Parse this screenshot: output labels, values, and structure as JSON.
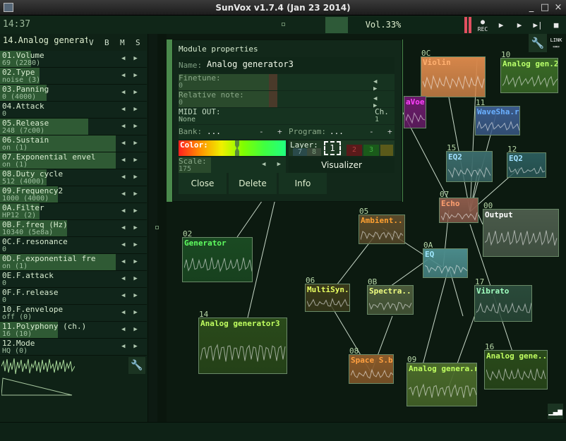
{
  "window": {
    "title": "SunVox v1.7.4 (Jan 23 2014)",
    "min": "_",
    "max": "□",
    "close": "×"
  },
  "topbar": {
    "time": "14:37",
    "volume": "Vol.33%",
    "rec": "REC",
    "play": "▶",
    "pattern_play": "▶",
    "loop": "▶|",
    "stop": "■",
    "link": "LINK"
  },
  "left_panel": {
    "module_name": "14.Analog generatǲ",
    "cols": [
      "V",
      "B",
      "M",
      "S"
    ],
    "params": [
      {
        "name": "01.Volume",
        "value": "69 (2280)",
        "fill": 0.27
      },
      {
        "name": "02.Type",
        "value": "noise (3)",
        "fill": 0.34
      },
      {
        "name": "03.Panning",
        "value": "0 (4000)",
        "fill": 0.4
      },
      {
        "name": "04.Attack",
        "value": "0",
        "fill": 0.0
      },
      {
        "name": "05.Release",
        "value": "248 (7c00)",
        "fill": 0.76
      },
      {
        "name": "06.Sustain",
        "value": "on (1)",
        "fill": 1.0
      },
      {
        "name": "07.Exponential envel",
        "value": "on (1)",
        "fill": 1.0
      },
      {
        "name": "08.Duty cycle",
        "value": "512 (4000)",
        "fill": 0.4
      },
      {
        "name": "09.Frequency2",
        "value": "1000 (4000)",
        "fill": 0.5
      },
      {
        "name": "0A.Filter",
        "value": "HP12 (2)",
        "fill": 0.34
      },
      {
        "name": "0B.F.freq (Hz)",
        "value": "10340 (5e8a)",
        "fill": 0.58
      },
      {
        "name": "0C.F.resonance",
        "value": "0",
        "fill": 0.0
      },
      {
        "name": "0D.F.exponential fre",
        "value": "on (1)",
        "fill": 1.0
      },
      {
        "name": "0E.F.attack",
        "value": "0",
        "fill": 0.0
      },
      {
        "name": "0F.F.release",
        "value": "0",
        "fill": 0.0
      },
      {
        "name": "10.F.envelope",
        "value": "off (0)",
        "fill": 0.0
      },
      {
        "name": "11.Polyphony (ch.)",
        "value": "16 (10)",
        "fill": 0.5
      },
      {
        "name": "12.Mode",
        "value": "HQ (0)",
        "fill": 0.0
      }
    ]
  },
  "dialog": {
    "title": "Module properties",
    "name_label": "Name:",
    "name_value": "Analog generator3",
    "finetune_label": "Finetune:",
    "finetune_value": "0",
    "relnote_label": "Relative note:",
    "relnote_value": "0",
    "midi_label": "MIDI OUT:",
    "midi_value": "None",
    "ch_label": "Ch.",
    "ch_value": "1",
    "bank_label": "Bank:",
    "bank_value": "...",
    "program_label": "Program:",
    "program_value": "...",
    "color_label": "Color:",
    "layer_label": "Layer:",
    "layers": [
      "7",
      "8",
      "1",
      "2",
      "3"
    ],
    "scale_label": "Scale:",
    "scale_value": "175",
    "visualizer": "Visualizer",
    "close": "Close",
    "delete": "Delete",
    "info": "Info",
    "minus": "-",
    "plus": "+"
  },
  "nodes": [
    {
      "id": "0C",
      "label": "Violin",
      "color": "#d6864a",
      "lcolor": "#ffb070"
    },
    {
      "id": "10",
      "label": "Analog gen.2",
      "color": "#3a6a26",
      "lcolor": "#b8ff6a"
    },
    {
      "id": "aVoe",
      "label": "aVoe",
      "color": "#6a1a6a",
      "lcolor": "#ff40ff"
    },
    {
      "id": "11",
      "label": "WaveSha.r",
      "color": "#3a5a8a",
      "lcolor": "#6ab0ff"
    },
    {
      "id": "15",
      "label": "EQ2",
      "color": "#3a6a6a",
      "lcolor": "#a0e0ff"
    },
    {
      "id": "12",
      "label": "EQ2",
      "color": "#2a5a5a",
      "lcolor": "#a0e0ff"
    },
    {
      "id": "07",
      "label": "Echo",
      "color": "#8a5a4a",
      "lcolor": "#ffa070"
    },
    {
      "id": "00",
      "label": "Output",
      "color": "#4a5a4a",
      "lcolor": "#ffffff"
    },
    {
      "id": "05",
      "label": "Ambient...o",
      "color": "#5a4a2a",
      "lcolor": "#ffa030"
    },
    {
      "id": "02",
      "label": "Generator",
      "color": "#1a4a22",
      "lcolor": "#60ff60"
    },
    {
      "id": "0A",
      "label": "EQ",
      "color": "#4a8a8a",
      "lcolor": "#a0e8ff"
    },
    {
      "id": "06",
      "label": "MultiSyn.h",
      "color": "#3a3a1a",
      "lcolor": "#e8ff60"
    },
    {
      "id": "0B",
      "label": "Spectra...e",
      "color": "#4a5a3a",
      "lcolor": "#f0ff80"
    },
    {
      "id": "17",
      "label": "Vibrato",
      "color": "#2a4a3a",
      "lcolor": "#a0ffc0"
    },
    {
      "id": "14",
      "label": "Analog generator3",
      "color": "#2a4a1a",
      "lcolor": "#c0ff60"
    },
    {
      "id": "08",
      "label": "Space S.b",
      "color": "#8a5a2a",
      "lcolor": "#ffa040"
    },
    {
      "id": "09",
      "label": "Analog genera.r",
      "color": "#4a6a2a",
      "lcolor": "#c0ff60"
    },
    {
      "id": "16",
      "label": "Analog gene..2",
      "color": "#2a4a1a",
      "lcolor": "#c0ff60"
    }
  ]
}
